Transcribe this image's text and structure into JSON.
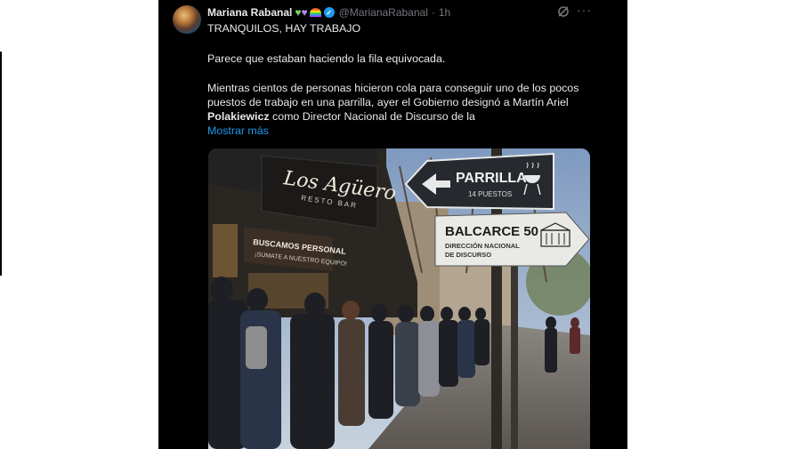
{
  "tweet": {
    "author_name": "Mariana Rabanal",
    "author_handle": "@MarianaRabanal",
    "separator": "·",
    "time": "1h",
    "headline": "TRANQUILOS, HAY TRABAJO",
    "paragraph1": "Parece que estaban haciendo la fila equivocada.",
    "paragraph2_a": "Mientras cientos de personas hicieron cola para conseguir uno de los pocos puestos de trabajo en una parrilla, ayer el Gobierno designó a Martín Ariel ",
    "paragraph2_bold": "Polakiewicz",
    "paragraph2_b": " como Director Nacional de Discurso de la",
    "show_more": "Mostrar más",
    "more_menu": "···"
  },
  "icons": {
    "author_emojis": [
      "green-heart-icon",
      "purple-heart-icon",
      "rainbow-icon"
    ],
    "verified": "verified-badge-icon",
    "grok": "grok-icon",
    "more": "more-options-icon"
  },
  "image": {
    "restaurant_name": "Los Agüero",
    "restaurant_sub": "RESTO BAR",
    "window_sign_line1": "BUSCAMOS PERSONAL",
    "window_sign_line2": "¡SUMATE A NUESTRO EQUIPO!",
    "sign_top_title": "PARRILLA",
    "sign_top_sub": "14 PUESTOS",
    "sign_bottom_title": "BALCARCE 50",
    "sign_bottom_sub1": "DIRECCIÓN NACIONAL",
    "sign_bottom_sub2": "DE DISCURSO"
  },
  "colors": {
    "card_bg": "#000000",
    "text": "#e7e9ea",
    "muted": "#71767b",
    "link": "#1d9bf0"
  }
}
